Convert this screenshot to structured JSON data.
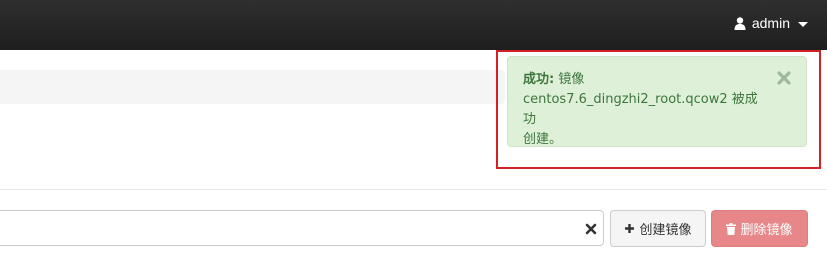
{
  "navbar": {
    "user_label": "admin",
    "user_icon": "user-icon"
  },
  "alert": {
    "title": "成功:",
    "message_line1": " 镜像",
    "message_line2": "centos7.6_dingzhi2_root.qcow2 被成功",
    "message_line3": "创建。",
    "close_icon": "close-icon",
    "colors": {
      "background": "#dff0d8",
      "text": "#3c763d",
      "highlight_border": "#d32024"
    }
  },
  "toolbar": {
    "search_value": "",
    "search_placeholder": "",
    "clear_icon": "times-icon",
    "create_label": "创建镜像",
    "create_icon": "plus-icon",
    "delete_label": "删除镜像",
    "delete_icon": "trash-icon",
    "delete_color": "#e7878a"
  }
}
